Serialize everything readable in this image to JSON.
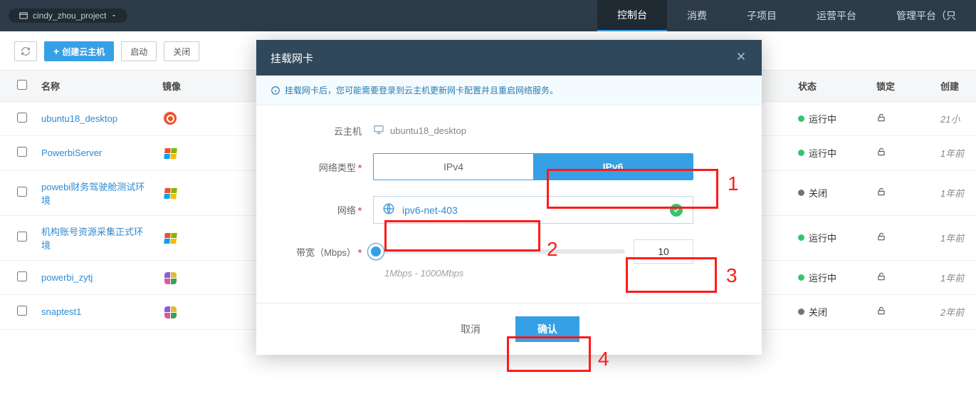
{
  "topbar": {
    "project_name": "cindy_zhou_project",
    "tabs": [
      "控制台",
      "消费",
      "子项目",
      "运营平台",
      "管理平台（只"
    ]
  },
  "toolbar": {
    "create_label": "创建云主机",
    "start_label": "启动",
    "stop_label": "关闭"
  },
  "table": {
    "headers": {
      "name": "名称",
      "image": "镜像",
      "status": "状态",
      "lock": "锁定",
      "created": "创建"
    },
    "rows": [
      {
        "name": "ubuntu18_desktop",
        "os": "ubuntu",
        "status_text": "运行中",
        "status_kind": "run",
        "time": "21小"
      },
      {
        "name": "PowerbiServer",
        "os": "windows",
        "status_text": "运行中",
        "status_kind": "run",
        "time": "1年前"
      },
      {
        "name": "powebi财务驾驶舱测试环境",
        "os": "windows",
        "status_text": "关闭",
        "status_kind": "stop",
        "time": "1年前"
      },
      {
        "name": "机构账号资源采集正式环境",
        "os": "windows",
        "status_text": "运行中",
        "status_kind": "run",
        "time": "1年前"
      },
      {
        "name": "powerbi_zytj",
        "os": "puzzle",
        "status_text": "运行中",
        "status_kind": "run",
        "time": "1年前"
      },
      {
        "name": "snaptest1",
        "os": "puzzle",
        "status_text": "关闭",
        "status_kind": "stop",
        "time": "2年前"
      }
    ]
  },
  "modal": {
    "title": "挂载网卡",
    "info_text": "挂载网卡后，您可能需要登录到云主机更新网卡配置并且重启网络服务。",
    "labels": {
      "vm": "云主机",
      "net_type": "网络类型",
      "network": "网络",
      "bandwidth": "带宽（Mbps）"
    },
    "vm_name": "ubuntu18_desktop",
    "net_types": {
      "ipv4": "IPv4",
      "ipv6": "IPv6"
    },
    "network_value": "ipv6-net-403",
    "bandwidth_value": "10",
    "bandwidth_hint": "1Mbps - 1000Mbps",
    "buttons": {
      "cancel": "取消",
      "confirm": "确认"
    }
  },
  "annotations": {
    "l1": "1",
    "l2": "2",
    "l3": "3",
    "l4": "4"
  }
}
